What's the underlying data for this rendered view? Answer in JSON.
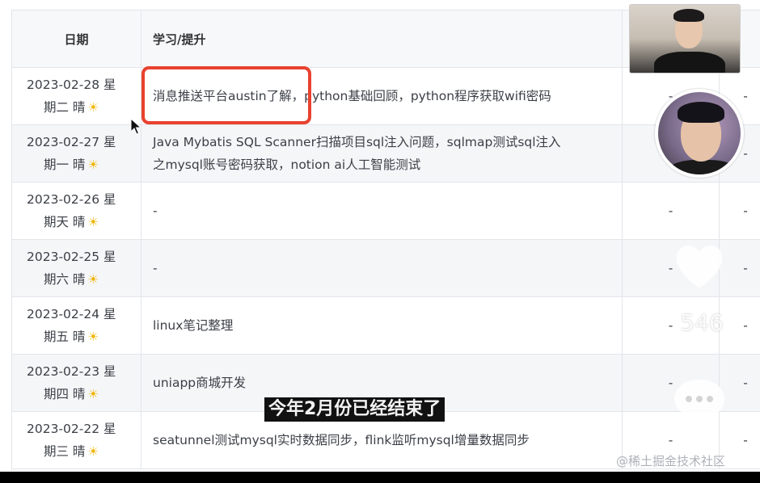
{
  "table": {
    "headers": {
      "date": "日期",
      "study": "学习/提升"
    },
    "rows": [
      {
        "date": "2023-02-28 星",
        "weekday": "期二 晴",
        "study_1": "消息推送平台austin了解，python基础回顾，python程序获取wifi密码",
        "study_2": "",
        "extra": "-"
      },
      {
        "date": "2023-02-27 星",
        "weekday": "期一 晴",
        "study_1": "Java Mybatis SQL Scanner扫描项目sql注入问题，sqlmap测试sql注入",
        "study_2": "之mysql账号密码获取，notion ai人工智能测试",
        "extra": "-"
      },
      {
        "date": "2023-02-26 星",
        "weekday": "期天 晴",
        "study_1": "-",
        "study_2": "",
        "extra": "-"
      },
      {
        "date": "2023-02-25 星",
        "weekday": "期六 晴",
        "study_1": "-",
        "study_2": "",
        "extra": "-"
      },
      {
        "date": "2023-02-24 星",
        "weekday": "期五 晴",
        "study_1": "linux笔记整理",
        "study_2": "",
        "extra": "-"
      },
      {
        "date": "2023-02-23 星",
        "weekday": "期四 晴",
        "study_1": "uniapp商城开发",
        "study_2": "",
        "extra": "-"
      },
      {
        "date": "2023-02-22 星",
        "weekday": "期三 晴",
        "study_1": "seatunnel测试mysql实时数据同步，flink监听mysql增量数据同步",
        "study_2": "",
        "extra": "-"
      }
    ],
    "weather_icon": "sun-icon"
  },
  "overlay": {
    "like_count": "546",
    "caption": "今年2月份已经结束了",
    "watermark": "@稀土掘金技术社区"
  },
  "colors": {
    "highlight": "#e8422f",
    "sun": "#f0b400",
    "row_alt": "#f5f6f8"
  }
}
